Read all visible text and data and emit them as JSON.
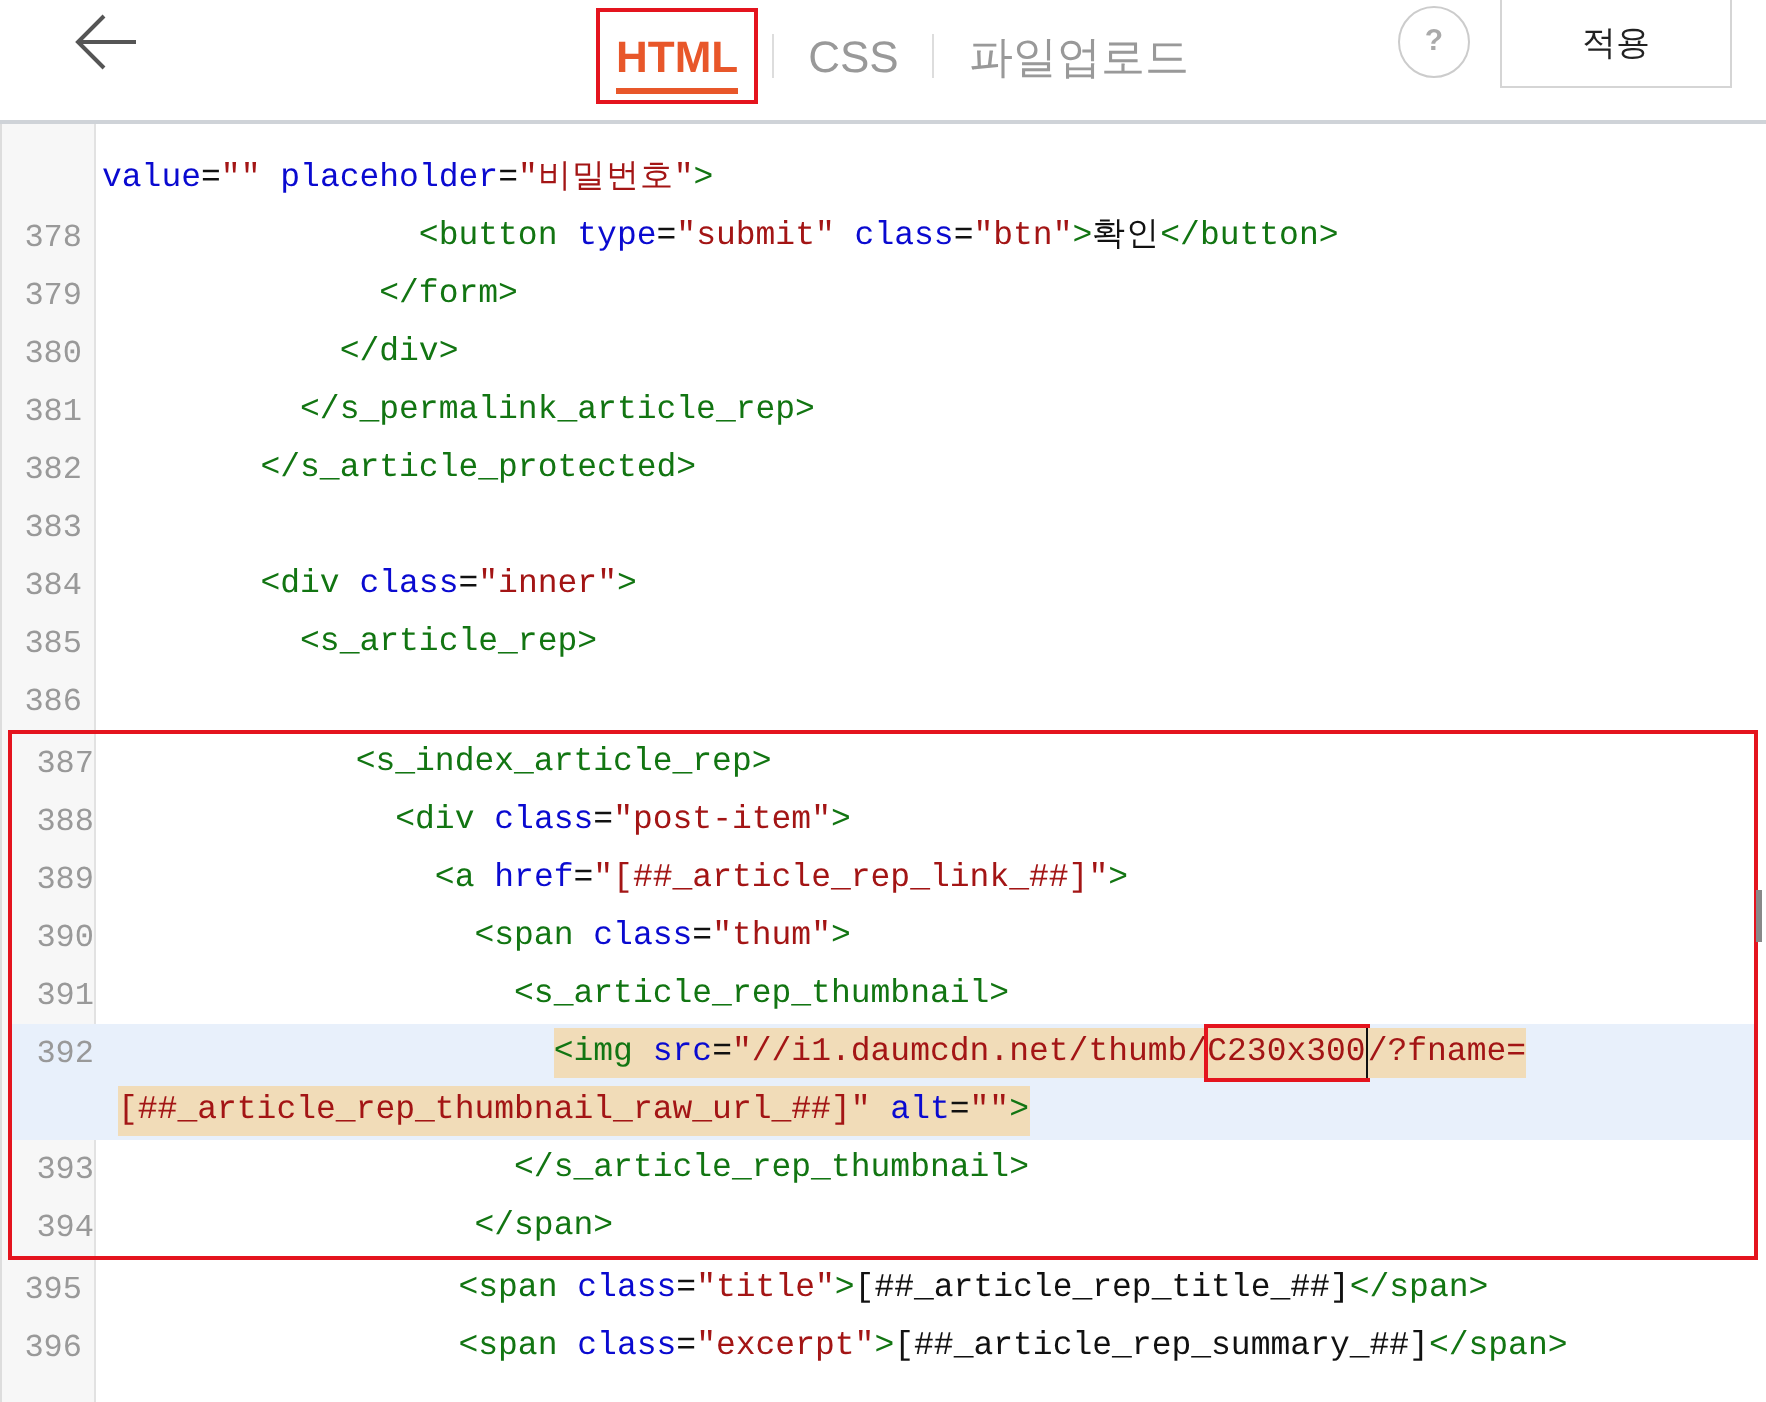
{
  "header": {
    "tabs": [
      {
        "label": "HTML",
        "selected": true,
        "boxed": true
      },
      {
        "label": "CSS",
        "selected": false,
        "boxed": false
      },
      {
        "label": "파일업로드",
        "selected": false,
        "boxed": false
      }
    ],
    "help": "?",
    "apply_button": "적용"
  },
  "editor": {
    "lines": [
      {
        "rows": [
          {
            "tokens": [
              {
                "kind": "attr",
                "text": "value"
              },
              {
                "kind": "punct",
                "text": "="
              },
              {
                "kind": "string",
                "text": "\"\""
              },
              {
                "kind": "attr",
                "text": " placeholder"
              },
              {
                "kind": "punct",
                "text": "="
              },
              {
                "kind": "string",
                "text": "\"비밀번호\""
              },
              {
                "kind": "tag",
                "text": ">"
              }
            ]
          }
        ],
        "in_box": false,
        "current": false
      },
      {
        "number": "378",
        "rows": [
          {
            "tokens": [
              {
                "kind": "tag",
                "text": "                <button"
              },
              {
                "kind": "attr",
                "text": " type"
              },
              {
                "kind": "punct",
                "text": "="
              },
              {
                "kind": "string",
                "text": "\"submit\""
              },
              {
                "kind": "attr",
                "text": " class"
              },
              {
                "kind": "punct",
                "text": "="
              },
              {
                "kind": "string",
                "text": "\"btn\""
              },
              {
                "kind": "tag",
                "text": ">"
              },
              {
                "kind": "text",
                "text": "확인"
              },
              {
                "kind": "tag",
                "text": "</button>"
              }
            ]
          }
        ],
        "in_box": false,
        "current": false
      },
      {
        "number": "379",
        "rows": [
          {
            "tokens": [
              {
                "kind": "tag",
                "text": "              </form>"
              }
            ]
          }
        ],
        "in_box": false,
        "current": false
      },
      {
        "number": "380",
        "rows": [
          {
            "tokens": [
              {
                "kind": "tag",
                "text": "            </div>"
              }
            ]
          }
        ],
        "in_box": false,
        "current": false
      },
      {
        "number": "381",
        "rows": [
          {
            "tokens": [
              {
                "kind": "tag",
                "text": "          </s_permalink_article_rep>"
              }
            ]
          }
        ],
        "in_box": false,
        "current": false
      },
      {
        "number": "382",
        "rows": [
          {
            "tokens": [
              {
                "kind": "tag",
                "text": "        </s_article_protected>"
              }
            ]
          }
        ],
        "in_box": false,
        "current": false
      },
      {
        "number": "383",
        "rows": [
          {}
        ],
        "in_box": false,
        "current": false
      },
      {
        "number": "384",
        "rows": [
          {
            "tokens": [
              {
                "kind": "tag",
                "text": "        <div"
              },
              {
                "kind": "attr",
                "text": " class"
              },
              {
                "kind": "punct",
                "text": "="
              },
              {
                "kind": "string",
                "text": "\"inner\""
              },
              {
                "kind": "tag",
                "text": ">"
              }
            ]
          }
        ],
        "in_box": false,
        "current": false
      },
      {
        "number": "385",
        "rows": [
          {
            "tokens": [
              {
                "kind": "tag",
                "text": "          <s_article_rep>"
              }
            ]
          }
        ],
        "in_box": false,
        "current": false
      },
      {
        "number": "386",
        "rows": [
          {}
        ],
        "in_box": false,
        "current": false
      },
      {
        "number": "387",
        "rows": [
          {
            "tokens": [
              {
                "kind": "tag",
                "text": "            <s_index_article_rep>"
              }
            ]
          }
        ],
        "in_box": true,
        "current": false
      },
      {
        "number": "388",
        "rows": [
          {
            "tokens": [
              {
                "kind": "tag",
                "text": "              <div"
              },
              {
                "kind": "attr",
                "text": " class"
              },
              {
                "kind": "punct",
                "text": "="
              },
              {
                "kind": "string",
                "text": "\"post-item\""
              },
              {
                "kind": "tag",
                "text": ">"
              }
            ]
          }
        ],
        "in_box": true,
        "current": false
      },
      {
        "number": "389",
        "rows": [
          {
            "tokens": [
              {
                "kind": "tag",
                "text": "                <a"
              },
              {
                "kind": "attr",
                "text": " href"
              },
              {
                "kind": "punct",
                "text": "="
              },
              {
                "kind": "string",
                "text": "\"[##_article_rep_link_##]\""
              },
              {
                "kind": "tag",
                "text": ">"
              }
            ]
          }
        ],
        "in_box": true,
        "current": false
      },
      {
        "number": "390",
        "rows": [
          {
            "tokens": [
              {
                "kind": "tag",
                "text": "                  <span"
              },
              {
                "kind": "attr",
                "text": " class"
              },
              {
                "kind": "punct",
                "text": "="
              },
              {
                "kind": "string",
                "text": "\"thum\""
              },
              {
                "kind": "tag",
                "text": ">"
              }
            ]
          }
        ],
        "in_box": true,
        "current": false
      },
      {
        "number": "391",
        "rows": [
          {
            "tokens": [
              {
                "kind": "tag",
                "text": "                    <s_article_rep_thumbnail>"
              }
            ]
          }
        ],
        "in_box": true,
        "current": false
      },
      {
        "number": "392",
        "rows": [
          {
            "tokens": [
              {
                "kind": "tag",
                "text": "                      <img",
                "match": true
              },
              {
                "kind": "attr",
                "text": " src",
                "match": true
              },
              {
                "kind": "punct",
                "text": "=",
                "match": true
              },
              {
                "kind": "string",
                "text": "\"//i1.daumcdn.net/thumb/",
                "match": true
              },
              {
                "kind": "string",
                "text": "C230x300",
                "match": true,
                "marked": true
              },
              {
                "kind": "string",
                "text": "/?fname=",
                "match": true,
                "cursor": true
              }
            ]
          },
          {
            "tokens": [
              {
                "kind": "string",
                "text": "[##_article_rep_thumbnail_raw_url_##]\"",
                "match": true
              },
              {
                "kind": "attr",
                "text": " alt",
                "match": true
              },
              {
                "kind": "punct",
                "text": "=",
                "match": true
              },
              {
                "kind": "string",
                "text": "\"\"",
                "match": true
              },
              {
                "kind": "tag",
                "text": ">",
                "match": true
              }
            ]
          }
        ],
        "in_box": true,
        "current": true
      },
      {
        "number": "393",
        "rows": [
          {
            "tokens": [
              {
                "kind": "tag",
                "text": "                    </s_article_rep_thumbnail>"
              }
            ]
          }
        ],
        "in_box": true,
        "current": false
      },
      {
        "number": "394",
        "rows": [
          {
            "tokens": [
              {
                "kind": "tag",
                "text": "                  </span>"
              }
            ]
          }
        ],
        "in_box": true,
        "current": false
      },
      {
        "number": "395",
        "rows": [
          {
            "tokens": [
              {
                "kind": "tag",
                "text": "                  <span"
              },
              {
                "kind": "attr",
                "text": " class"
              },
              {
                "kind": "punct",
                "text": "="
              },
              {
                "kind": "string",
                "text": "\"title\""
              },
              {
                "kind": "tag",
                "text": ">"
              },
              {
                "kind": "text",
                "text": "[##_article_rep_title_##]"
              },
              {
                "kind": "tag",
                "text": "</span>"
              }
            ]
          }
        ],
        "in_box": false,
        "current": false
      },
      {
        "number": "396",
        "rows": [
          {
            "tokens": [
              {
                "kind": "tag",
                "text": "                  <span"
              },
              {
                "kind": "attr",
                "text": " class"
              },
              {
                "kind": "punct",
                "text": "="
              },
              {
                "kind": "string",
                "text": "\"excerpt\""
              },
              {
                "kind": "tag",
                "text": ">"
              },
              {
                "kind": "text",
                "text": "[##_article_rep_summary_##]"
              },
              {
                "kind": "tag",
                "text": "</span>"
              }
            ]
          }
        ],
        "in_box": false,
        "current": false
      }
    ]
  }
}
